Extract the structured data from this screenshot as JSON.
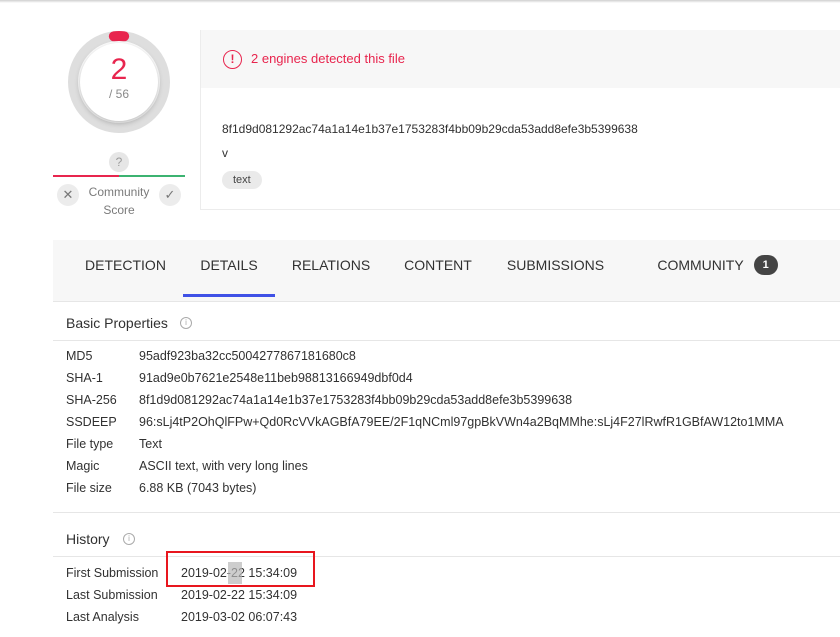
{
  "score": {
    "detected": "2",
    "total": "/ 56",
    "detection_fraction": 0.0357,
    "community_question": "?",
    "community_label": "Community Score",
    "vote_down_symbol": "✕",
    "vote_up_symbol": "✓"
  },
  "header": {
    "alert_icon": "!",
    "alert_text": "2 engines detected this file",
    "hash": "8f1d9d081292ac74a1a14e1b37e1753283f4bb09b29cda53add8efe3b5399638",
    "filename": "v",
    "tag": "text"
  },
  "tabs": [
    {
      "label": "DETECTION"
    },
    {
      "label": "DETAILS"
    },
    {
      "label": "RELATIONS"
    },
    {
      "label": "CONTENT"
    },
    {
      "label": "SUBMISSIONS"
    },
    {
      "label": "COMMUNITY",
      "badge": "1"
    }
  ],
  "active_tab": "DETAILS",
  "basic_properties": {
    "title": "Basic Properties",
    "rows": [
      {
        "key": "MD5",
        "value": "95adf923ba32cc5004277867181680c8"
      },
      {
        "key": "SHA-1",
        "value": "91ad9e0b7621e2548e11beb98813166949dbf0d4"
      },
      {
        "key": "SHA-256",
        "value": "8f1d9d081292ac74a1a14e1b37e1753283f4bb09b29cda53add8efe3b5399638"
      },
      {
        "key": "SSDEEP",
        "value": "96:sLj4tP2OhQlFPw+Qd0RcVVkAGBfA79EE/2F1qNCml97gpBkVWn4a2BqMMhe:sLj4F27lRwfR1GBfAW12to1MMA"
      },
      {
        "key": "File type",
        "value": "Text"
      },
      {
        "key": "Magic",
        "value": "ASCII text, with very long lines"
      },
      {
        "key": "File size",
        "value": "6.88 KB (7043 bytes)"
      }
    ]
  },
  "history": {
    "title": "History",
    "rows": [
      {
        "key": "First Submission",
        "value": "2019-02-22 15:34:09"
      },
      {
        "key": "Last Submission",
        "value": "2019-02-22 15:34:09"
      },
      {
        "key": "Last Analysis",
        "value": "2019-03-02 06:07:43"
      }
    ]
  },
  "colors": {
    "alert": "#e8254e",
    "active_tab_underline": "#3f51e6",
    "annotation_box": "#e8161e",
    "community_negative": "#e8254e",
    "community_positive": "#3cb371"
  }
}
